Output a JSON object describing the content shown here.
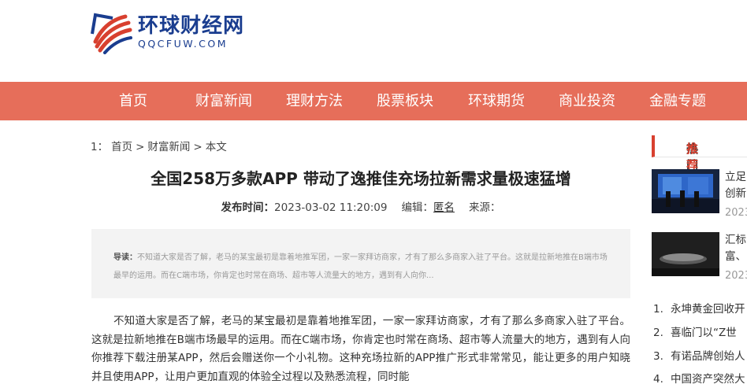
{
  "site": {
    "name_cn": "环球财经网",
    "name_en": "QQCFUW.COM"
  },
  "colors": {
    "nav_bg": "#e66e5a",
    "brand_blue": "#1a3d8f",
    "accent_red": "#d8402f",
    "summary_bg": "#f3f3f3"
  },
  "nav": {
    "items": [
      "首页",
      "财富新闻",
      "理财方法",
      "股票板块",
      "环球期货",
      "商业投资",
      "金融专题"
    ]
  },
  "breadcrumb": {
    "prefix": "1：",
    "home": "首页",
    "sep1": ">",
    "category": "财富新闻",
    "sep2": ">",
    "current": "本文"
  },
  "article": {
    "title": "全国258万多款APP 带动了逸推佳充场拉新需求量极速猛增",
    "publish_label": "发布时间：",
    "publish_time": "2023-03-02 11:20:09",
    "editor_label": "编辑：",
    "editor": "匿名",
    "source_label": "来源：",
    "summary_label": "导读：",
    "summary_text": "不知道大家是否了解，老马的某宝最初是靠着地推军团，一家一家拜访商家，才有了那么多商家入驻了平台。这就是拉新地推在B端市场最早的运用。而在C端市场，你肯定也时常在商场、超市等人流量大的地方，遇到有人向你...",
    "body": "不知道大家是否了解，老马的某宝最初是靠着地推军团，一家一家拜访商家，才有了那么多商家入驻了平台。这就是拉新地推在B端市场最早的运用。而在C端市场，你肯定也时常在商场、超市等人流量大的地方，遇到有人向你推荐下载注册某APP，然后会赠送你一个小礼物。这种充场拉新的APP推广形式非常常见，能让更多的用户知晓并且使用APP，让用户更加直观的体验全过程以及熟悉流程，同时能"
  },
  "sidebar": {
    "heading_black": "热门",
    "heading_red": "推荐",
    "cards": [
      {
        "line1": "立足",
        "line2": "创新",
        "date": "2023"
      },
      {
        "line1": "汇标",
        "line2": "富、",
        "date": "2023"
      }
    ],
    "ranks": [
      {
        "n": "1.",
        "text": "永坤黄金回收开"
      },
      {
        "n": "2.",
        "text": "喜临门以“Z世"
      },
      {
        "n": "3.",
        "text": "有诺品牌创始人"
      },
      {
        "n": "4.",
        "text": "中国资产突然大"
      }
    ]
  }
}
